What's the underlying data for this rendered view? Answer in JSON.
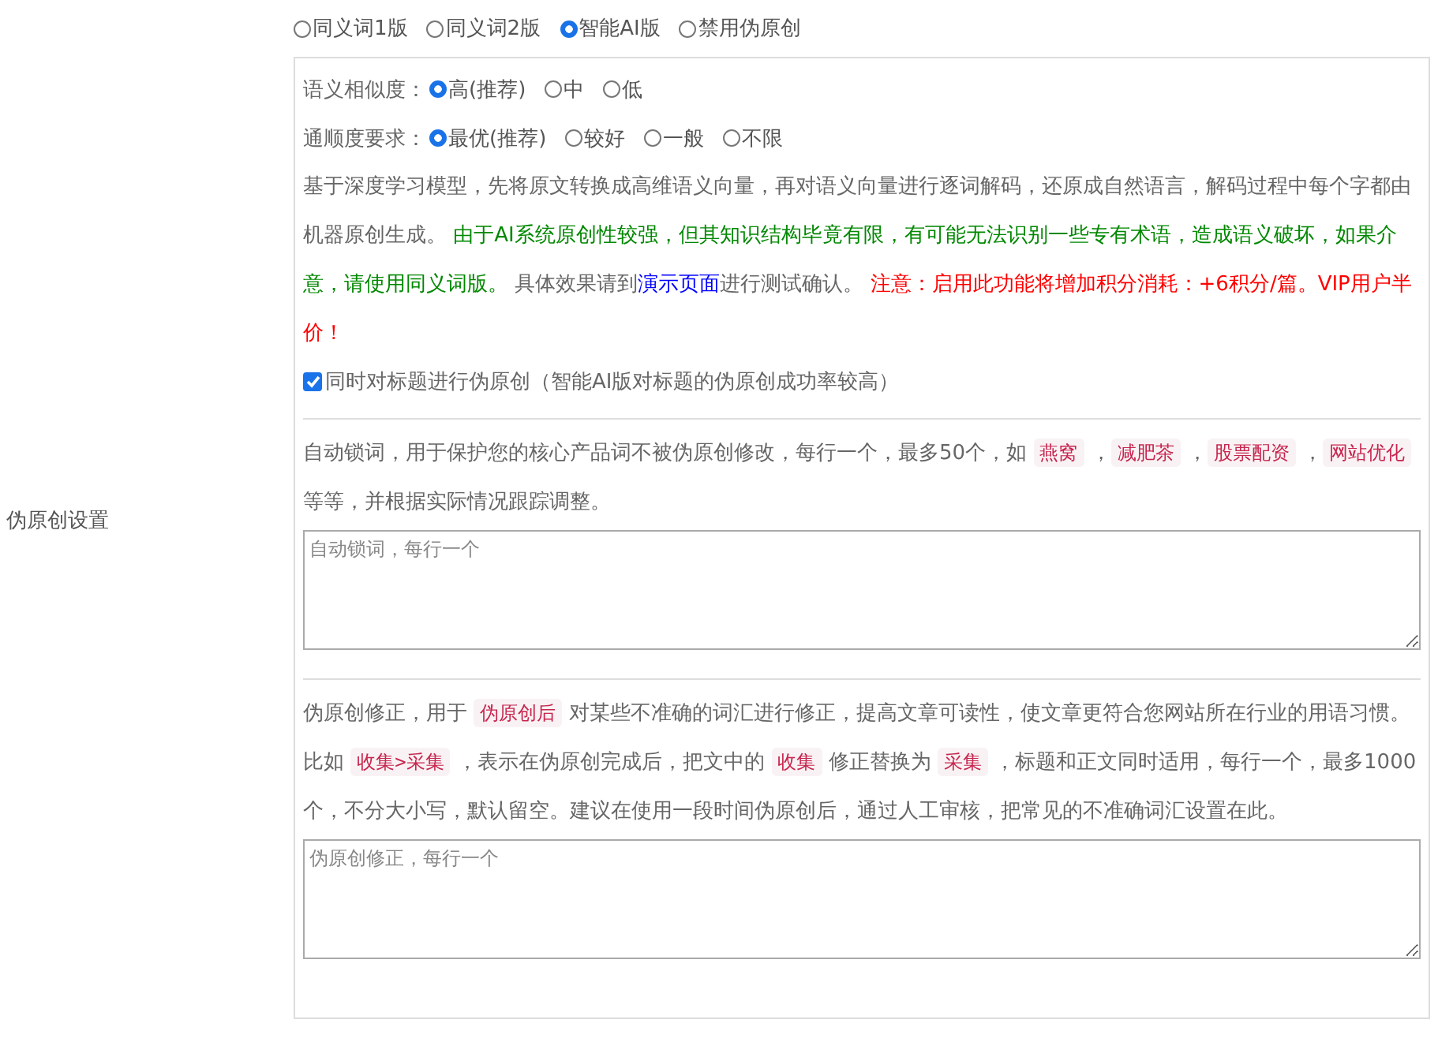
{
  "side_label": "伪原创设置",
  "modes": [
    {
      "label": "同义词1版",
      "selected": false
    },
    {
      "label": "同义词2版",
      "selected": false
    },
    {
      "label": "智能AI版",
      "selected": true
    },
    {
      "label": "禁用伪原创",
      "selected": false
    }
  ],
  "similarity": {
    "label": "语义相似度：",
    "options": [
      {
        "label": "高(推荐)",
        "selected": true
      },
      {
        "label": "中",
        "selected": false
      },
      {
        "label": "低",
        "selected": false
      }
    ]
  },
  "fluency": {
    "label": "通顺度要求：",
    "options": [
      {
        "label": "最优(推荐)",
        "selected": true
      },
      {
        "label": "较好",
        "selected": false
      },
      {
        "label": "一般",
        "selected": false
      },
      {
        "label": "不限",
        "selected": false
      }
    ]
  },
  "ai_description": [
    {
      "kind": "plain",
      "text": "基于深度学习模型，先将原文转换成高维语义向量，再对语义向量进行逐词解码，还原成自然语言，解码过程中每个字都由机器原创生成。 "
    },
    {
      "kind": "green",
      "text": "由于AI系统原创性较强，但其知识结构毕竟有限，有可能无法识别一些专有术语，造成语义破坏，如果介意，请使用同义词版。"
    },
    {
      "kind": "plain",
      "text": " 具体效果请到"
    },
    {
      "kind": "link",
      "text": "演示页面"
    },
    {
      "kind": "plain",
      "text": "进行测试确认。 "
    },
    {
      "kind": "red",
      "text": "注意：启用此功能将增加积分消耗：+6积分/篇。VIP用户半价！"
    }
  ],
  "title_option": {
    "label": "同时对标题进行伪原创（智能AI版对标题的伪原创成功率较高）",
    "checked": true
  },
  "lock_words": {
    "description": [
      {
        "kind": "plain",
        "text": "自动锁词，用于保护您的核心产品词不被伪原创修改，每行一个，最多50个，如 "
      },
      {
        "kind": "code",
        "text": "燕窝"
      },
      {
        "kind": "plain",
        "text": " ，"
      },
      {
        "kind": "code",
        "text": "减肥茶"
      },
      {
        "kind": "plain",
        "text": " ，"
      },
      {
        "kind": "code",
        "text": "股票配资"
      },
      {
        "kind": "plain",
        "text": " ，"
      },
      {
        "kind": "code",
        "text": "网站优化"
      },
      {
        "kind": "plain",
        "text": " 等等，并根据实际情况跟踪调整。"
      }
    ],
    "placeholder": "自动锁词，每行一个"
  },
  "corrections": {
    "description": [
      {
        "kind": "plain",
        "text": "伪原创修正，用于 "
      },
      {
        "kind": "code",
        "text": "伪原创后"
      },
      {
        "kind": "plain",
        "text": " 对某些不准确的词汇进行修正，提高文章可读性，使文章更符合您网站所在行业的用语习惯。比如 "
      },
      {
        "kind": "code",
        "text": "收集>采集"
      },
      {
        "kind": "plain",
        "text": " ，表示在伪原创完成后，把文中的 "
      },
      {
        "kind": "code",
        "text": "收集"
      },
      {
        "kind": "plain",
        "text": " 修正替换为 "
      },
      {
        "kind": "code",
        "text": "采集"
      },
      {
        "kind": "plain",
        "text": " ，标题和正文同时适用，每行一个，最多1000个，不分大小写，默认留空。建议在使用一段时间伪原创后，通过人工审核，把常见的不准确词汇设置在此。"
      }
    ],
    "placeholder": "伪原创修正，每行一个"
  }
}
